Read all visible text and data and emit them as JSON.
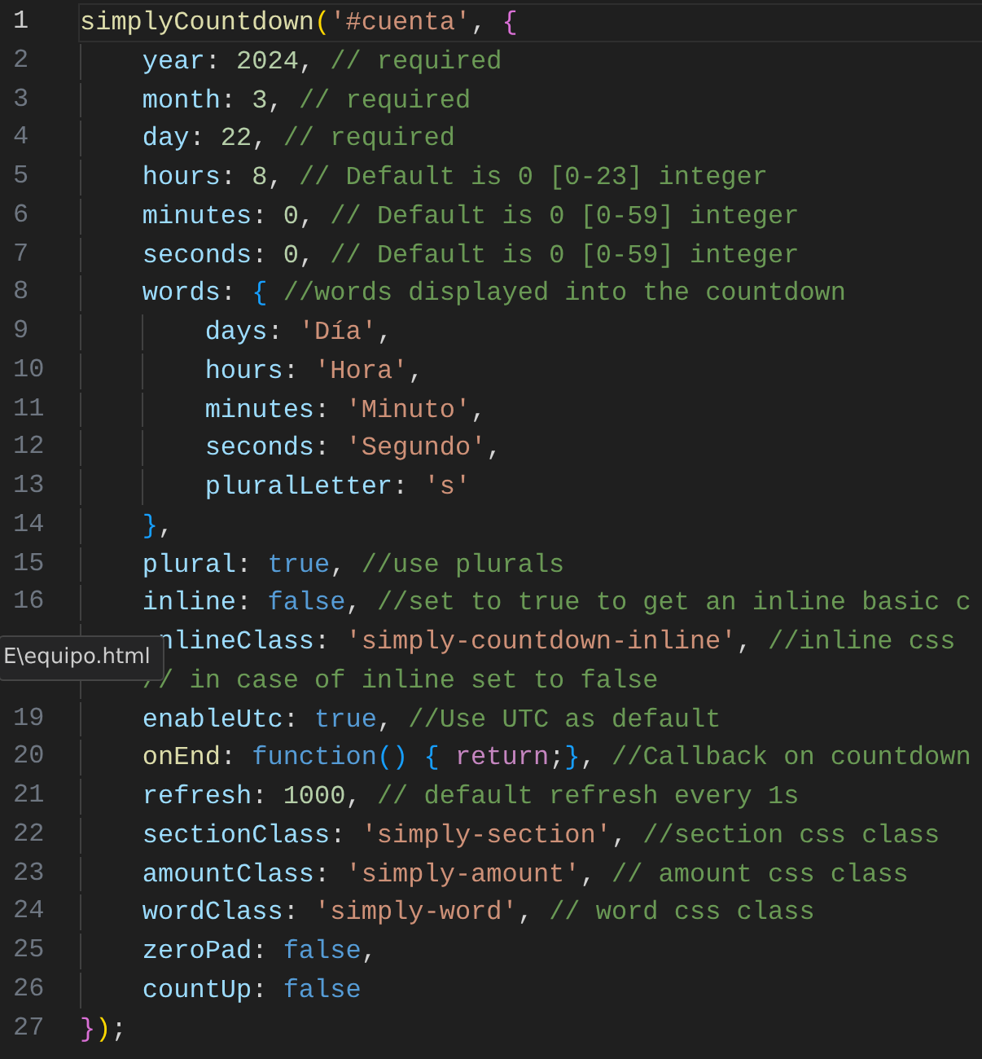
{
  "lines": [
    {
      "number": "1",
      "active": true,
      "kind": "root",
      "tokens": [
        {
          "kind": "fn",
          "text": "simplyCountdown"
        },
        {
          "kind": "b1",
          "text": "("
        },
        {
          "kind": "str",
          "text": "'#cuenta'"
        },
        {
          "kind": "p",
          "text": ", "
        },
        {
          "kind": "b2",
          "text": "{"
        }
      ]
    },
    {
      "number": "2",
      "active": false,
      "kind": "member",
      "tokens": [
        {
          "kind": "prop",
          "text": "year"
        },
        {
          "kind": "p",
          "text": ": "
        },
        {
          "kind": "num",
          "text": "2024"
        },
        {
          "kind": "p",
          "text": ", "
        },
        {
          "kind": "com",
          "text": "// required"
        }
      ]
    },
    {
      "number": "3",
      "active": false,
      "kind": "member",
      "tokens": [
        {
          "kind": "prop",
          "text": "month"
        },
        {
          "kind": "p",
          "text": ": "
        },
        {
          "kind": "num",
          "text": "3"
        },
        {
          "kind": "p",
          "text": ", "
        },
        {
          "kind": "com",
          "text": "// required"
        }
      ]
    },
    {
      "number": "4",
      "active": false,
      "kind": "member",
      "tokens": [
        {
          "kind": "prop",
          "text": "day"
        },
        {
          "kind": "p",
          "text": ": "
        },
        {
          "kind": "num",
          "text": "22"
        },
        {
          "kind": "p",
          "text": ", "
        },
        {
          "kind": "com",
          "text": "// required"
        }
      ]
    },
    {
      "number": "5",
      "active": false,
      "kind": "member",
      "tokens": [
        {
          "kind": "prop",
          "text": "hours"
        },
        {
          "kind": "p",
          "text": ": "
        },
        {
          "kind": "num",
          "text": "8"
        },
        {
          "kind": "p",
          "text": ", "
        },
        {
          "kind": "com",
          "text": "// Default is 0 [0-23] integer"
        }
      ]
    },
    {
      "number": "6",
      "active": false,
      "kind": "member",
      "tokens": [
        {
          "kind": "prop",
          "text": "minutes"
        },
        {
          "kind": "p",
          "text": ": "
        },
        {
          "kind": "num",
          "text": "0"
        },
        {
          "kind": "p",
          "text": ", "
        },
        {
          "kind": "com",
          "text": "// Default is 0 [0-59] integer"
        }
      ]
    },
    {
      "number": "7",
      "active": false,
      "kind": "member",
      "tokens": [
        {
          "kind": "prop",
          "text": "seconds"
        },
        {
          "kind": "p",
          "text": ": "
        },
        {
          "kind": "num",
          "text": "0"
        },
        {
          "kind": "p",
          "text": ", "
        },
        {
          "kind": "com",
          "text": "// Default is 0 [0-59] integer"
        }
      ]
    },
    {
      "number": "8",
      "active": false,
      "kind": "member",
      "tokens": [
        {
          "kind": "prop",
          "text": "words"
        },
        {
          "kind": "p",
          "text": ": "
        },
        {
          "kind": "b3",
          "text": "{"
        },
        {
          "kind": "com",
          "text": " //words displayed into the countdown"
        }
      ]
    },
    {
      "number": "9",
      "active": false,
      "kind": "inner",
      "tokens": [
        {
          "kind": "prop",
          "text": "days"
        },
        {
          "kind": "p",
          "text": ": "
        },
        {
          "kind": "str",
          "text": "'Día'"
        },
        {
          "kind": "p",
          "text": ","
        }
      ]
    },
    {
      "number": "10",
      "active": false,
      "kind": "inner",
      "tokens": [
        {
          "kind": "prop",
          "text": "hours"
        },
        {
          "kind": "p",
          "text": ": "
        },
        {
          "kind": "str",
          "text": "'Hora'"
        },
        {
          "kind": "p",
          "text": ","
        }
      ]
    },
    {
      "number": "11",
      "active": false,
      "kind": "inner",
      "tokens": [
        {
          "kind": "prop",
          "text": "minutes"
        },
        {
          "kind": "p",
          "text": ": "
        },
        {
          "kind": "str",
          "text": "'Minuto'"
        },
        {
          "kind": "p",
          "text": ","
        }
      ]
    },
    {
      "number": "12",
      "active": false,
      "kind": "inner",
      "tokens": [
        {
          "kind": "prop",
          "text": "seconds"
        },
        {
          "kind": "p",
          "text": ": "
        },
        {
          "kind": "str",
          "text": "'Segundo'"
        },
        {
          "kind": "p",
          "text": ","
        }
      ]
    },
    {
      "number": "13",
      "active": false,
      "kind": "inner",
      "tokens": [
        {
          "kind": "prop",
          "text": "pluralLetter"
        },
        {
          "kind": "p",
          "text": ": "
        },
        {
          "kind": "str",
          "text": "'s'"
        }
      ]
    },
    {
      "number": "14",
      "active": false,
      "kind": "member",
      "tokens": [
        {
          "kind": "b3",
          "text": "}"
        },
        {
          "kind": "p",
          "text": ","
        }
      ]
    },
    {
      "number": "15",
      "active": false,
      "kind": "member",
      "tokens": [
        {
          "kind": "prop",
          "text": "plural"
        },
        {
          "kind": "p",
          "text": ": "
        },
        {
          "kind": "kw",
          "text": "true"
        },
        {
          "kind": "p",
          "text": ", "
        },
        {
          "kind": "com",
          "text": "//use plurals"
        }
      ]
    },
    {
      "number": "16",
      "active": false,
      "kind": "member",
      "tokens": [
        {
          "kind": "prop",
          "text": "inline"
        },
        {
          "kind": "p",
          "text": ": "
        },
        {
          "kind": "kw",
          "text": "false"
        },
        {
          "kind": "p",
          "text": ", "
        },
        {
          "kind": "com",
          "text": "//set to true to get an inline basic c"
        }
      ]
    },
    {
      "active": false,
      "kind": "shifted",
      "tokens": [
        {
          "kind": "prop",
          "text": "nlineClass"
        },
        {
          "kind": "p",
          "text": ": "
        },
        {
          "kind": "str",
          "text": "'simply-countdown-inline'"
        },
        {
          "kind": "p",
          "text": ", "
        },
        {
          "kind": "com",
          "text": "//inline css"
        }
      ]
    },
    {
      "active": false,
      "kind": "member",
      "tokens": [
        {
          "kind": "com",
          "text": "// in case of inline set to false"
        }
      ]
    },
    {
      "number": "19",
      "active": false,
      "kind": "member",
      "tokens": [
        {
          "kind": "prop",
          "text": "enableUtc"
        },
        {
          "kind": "p",
          "text": ": "
        },
        {
          "kind": "kw",
          "text": "true"
        },
        {
          "kind": "p",
          "text": ", "
        },
        {
          "kind": "com",
          "text": "//Use UTC as default"
        }
      ]
    },
    {
      "number": "20",
      "active": false,
      "kind": "member",
      "tokens": [
        {
          "kind": "fn",
          "text": "onEnd"
        },
        {
          "kind": "p",
          "text": ": "
        },
        {
          "kind": "kw",
          "text": "function"
        },
        {
          "kind": "b3",
          "text": "() { "
        },
        {
          "kind": "ctl",
          "text": "return"
        },
        {
          "kind": "p",
          "text": ";"
        },
        {
          "kind": "b3",
          "text": "}"
        },
        {
          "kind": "p",
          "text": ", "
        },
        {
          "kind": "com",
          "text": "//Callback on countdown"
        }
      ]
    },
    {
      "number": "21",
      "active": false,
      "kind": "member",
      "tokens": [
        {
          "kind": "prop",
          "text": "refresh"
        },
        {
          "kind": "p",
          "text": ": "
        },
        {
          "kind": "num",
          "text": "1000"
        },
        {
          "kind": "p",
          "text": ", "
        },
        {
          "kind": "com",
          "text": "// default refresh every 1s"
        }
      ]
    },
    {
      "number": "22",
      "active": false,
      "kind": "member",
      "tokens": [
        {
          "kind": "prop",
          "text": "sectionClass"
        },
        {
          "kind": "p",
          "text": ": "
        },
        {
          "kind": "str",
          "text": "'simply-section'"
        },
        {
          "kind": "p",
          "text": ", "
        },
        {
          "kind": "com",
          "text": "//section css class"
        }
      ]
    },
    {
      "number": "23",
      "active": false,
      "kind": "member",
      "tokens": [
        {
          "kind": "prop",
          "text": "amountClass"
        },
        {
          "kind": "p",
          "text": ": "
        },
        {
          "kind": "str",
          "text": "'simply-amount'"
        },
        {
          "kind": "p",
          "text": ", "
        },
        {
          "kind": "com",
          "text": "// amount css class"
        }
      ]
    },
    {
      "number": "24",
      "active": false,
      "kind": "member",
      "tokens": [
        {
          "kind": "prop",
          "text": "wordClass"
        },
        {
          "kind": "p",
          "text": ": "
        },
        {
          "kind": "str",
          "text": "'simply-word'"
        },
        {
          "kind": "p",
          "text": ", "
        },
        {
          "kind": "com",
          "text": "// word css class"
        }
      ]
    },
    {
      "number": "25",
      "active": false,
      "kind": "member",
      "tokens": [
        {
          "kind": "prop",
          "text": "zeroPad"
        },
        {
          "kind": "p",
          "text": ": "
        },
        {
          "kind": "kw",
          "text": "false"
        },
        {
          "kind": "p",
          "text": ","
        }
      ]
    },
    {
      "number": "26",
      "active": false,
      "kind": "member",
      "tokens": [
        {
          "kind": "prop",
          "text": "countUp"
        },
        {
          "kind": "p",
          "text": ": "
        },
        {
          "kind": "kw",
          "text": "false"
        }
      ]
    },
    {
      "number": "27",
      "active": false,
      "kind": "root",
      "tokens": [
        {
          "kind": "b2",
          "text": "}"
        },
        {
          "kind": "b1",
          "text": ")"
        },
        {
          "kind": "p",
          "text": ";"
        }
      ]
    }
  ],
  "tooltip": {
    "text": "E\\equipo.html"
  }
}
